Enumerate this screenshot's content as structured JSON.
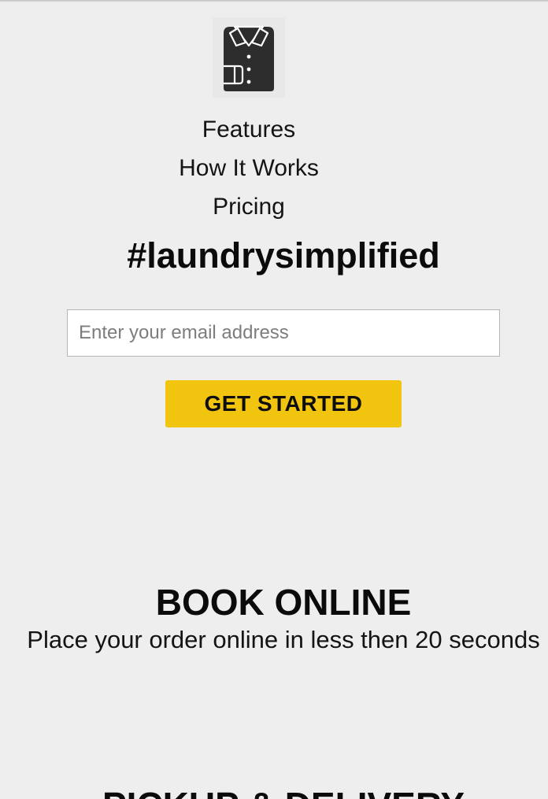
{
  "logo": {
    "icon": "shirt-icon"
  },
  "nav": {
    "items": [
      {
        "label": "Features"
      },
      {
        "label": "How It Works"
      },
      {
        "label": "Pricing"
      }
    ]
  },
  "hero": {
    "tagline": "#laundrysimplified",
    "email_placeholder": "Enter your email address",
    "email_value": "",
    "cta_label": "GET STARTED"
  },
  "sections": [
    {
      "title": "BOOK ONLINE",
      "subtitle": "Place your order online in less then 20 seconds"
    },
    {
      "title": "PICKUP & DELIVERY"
    }
  ],
  "colors": {
    "background": "#eeeeee",
    "accent": "#f1c40f",
    "text": "#111111"
  }
}
